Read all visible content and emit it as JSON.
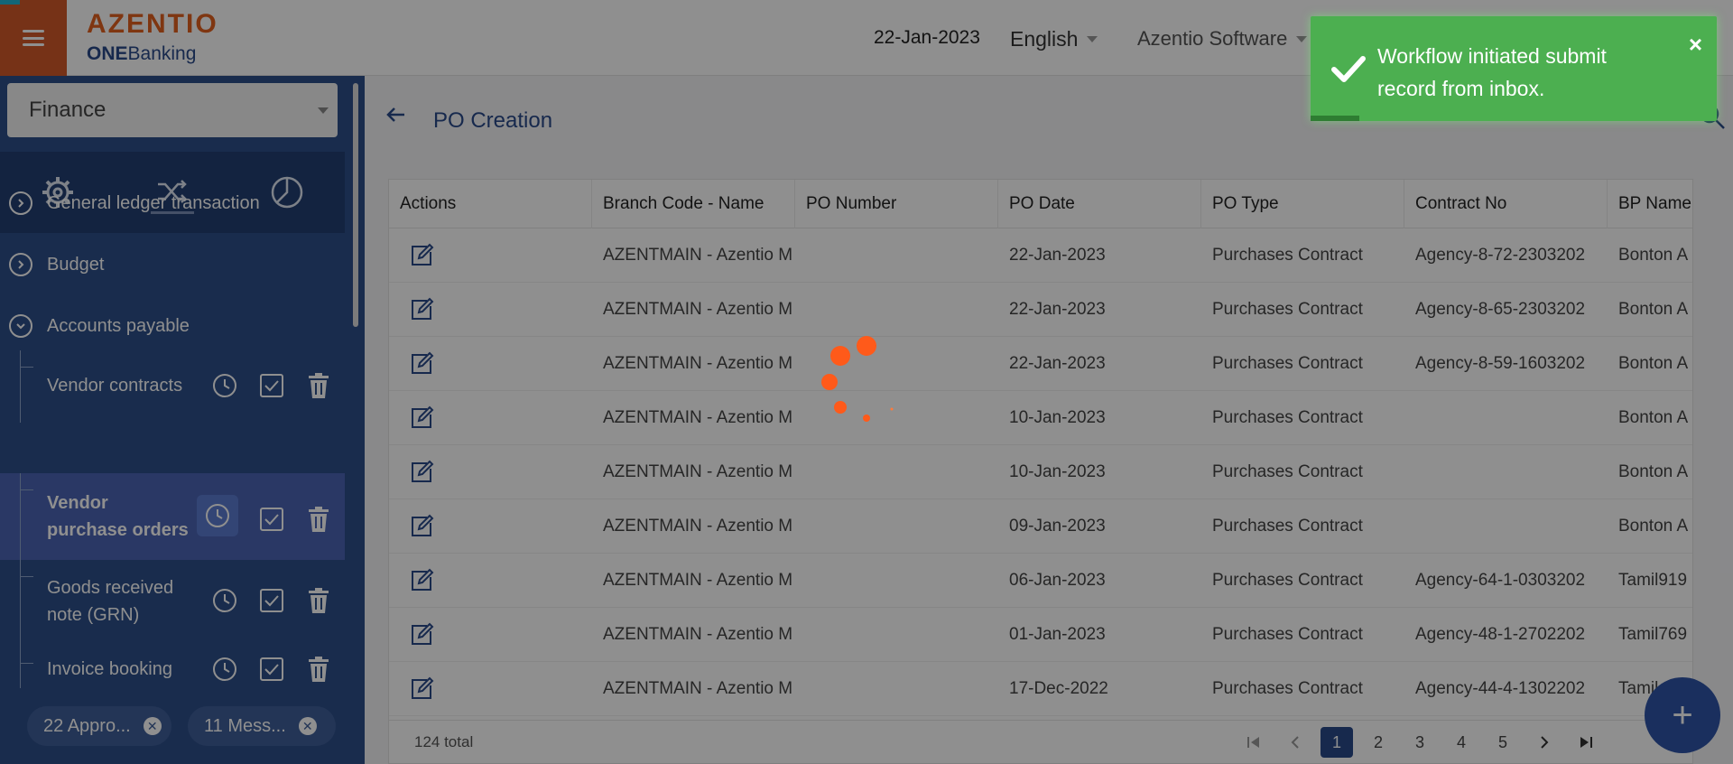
{
  "header": {
    "logo_main": "AZENTIO",
    "logo_sub_bold": "ONE",
    "logo_sub_rest": "Banking",
    "date": "22-Jan-2023",
    "language": "English",
    "company": "Azentio Software"
  },
  "sidebar": {
    "module": "Finance",
    "icons": [
      "gear-icon",
      "shuffle-icon",
      "pie-chart-icon"
    ],
    "menu": [
      {
        "label": "General ledger transaction",
        "state": "collapsed"
      },
      {
        "label": "Budget",
        "state": "collapsed"
      },
      {
        "label": "Accounts payable",
        "state": "expanded"
      }
    ],
    "sub_items": [
      {
        "label": "Vendor contracts"
      },
      {
        "label": "Vendor purchase orders",
        "active": true
      },
      {
        "label": "Goods received note (GRN)"
      },
      {
        "label": "Invoice booking"
      }
    ],
    "chips": [
      {
        "label": "22 Appro..."
      },
      {
        "label": "11 Mess..."
      }
    ]
  },
  "main": {
    "title": "PO Creation",
    "columns": [
      "Actions",
      "Branch Code - Name",
      "PO Number",
      "PO Date",
      "PO Type",
      "Contract No",
      "BP Name"
    ],
    "rows": [
      {
        "branch": "AZENTMAIN - Azentio M",
        "po_number": "",
        "po_date": "22-Jan-2023",
        "po_type": "Purchases Contract",
        "contract": "Agency-8-72-2303202",
        "bp": "Bonton A"
      },
      {
        "branch": "AZENTMAIN - Azentio M",
        "po_number": "",
        "po_date": "22-Jan-2023",
        "po_type": "Purchases Contract",
        "contract": "Agency-8-65-2303202",
        "bp": "Bonton A"
      },
      {
        "branch": "AZENTMAIN - Azentio M",
        "po_number": "",
        "po_date": "22-Jan-2023",
        "po_type": "Purchases Contract",
        "contract": "Agency-8-59-1603202",
        "bp": "Bonton A"
      },
      {
        "branch": "AZENTMAIN - Azentio M",
        "po_number": "",
        "po_date": "10-Jan-2023",
        "po_type": "Purchases Contract",
        "contract": "",
        "bp": "Bonton A"
      },
      {
        "branch": "AZENTMAIN - Azentio M",
        "po_number": "",
        "po_date": "10-Jan-2023",
        "po_type": "Purchases Contract",
        "contract": "",
        "bp": "Bonton A"
      },
      {
        "branch": "AZENTMAIN - Azentio M",
        "po_number": "",
        "po_date": "09-Jan-2023",
        "po_type": "Purchases Contract",
        "contract": "",
        "bp": "Bonton A"
      },
      {
        "branch": "AZENTMAIN - Azentio M",
        "po_number": "",
        "po_date": "06-Jan-2023",
        "po_type": "Purchases Contract",
        "contract": "Agency-64-1-0303202",
        "bp": "Tamil919"
      },
      {
        "branch": "AZENTMAIN - Azentio M",
        "po_number": "",
        "po_date": "01-Jan-2023",
        "po_type": "Purchases Contract",
        "contract": "Agency-48-1-2702202",
        "bp": "Tamil769"
      },
      {
        "branch": "AZENTMAIN - Azentio M",
        "po_number": "",
        "po_date": "17-Dec-2022",
        "po_type": "Purchases Contract",
        "contract": "Agency-44-4-1302202",
        "bp": "Tamil"
      }
    ],
    "total": "124 total",
    "pages": [
      "1",
      "2",
      "3",
      "4",
      "5"
    ],
    "current_page": "1"
  },
  "toast": {
    "message": "Workflow initiated submit record from inbox.",
    "close": "×",
    "color": "#4caf50"
  },
  "fab": {
    "label": "+"
  },
  "colors": {
    "brand_orange": "#e2611f",
    "sidebar_blue": "#2d4f8a",
    "spinner": "#ff5a1a"
  }
}
